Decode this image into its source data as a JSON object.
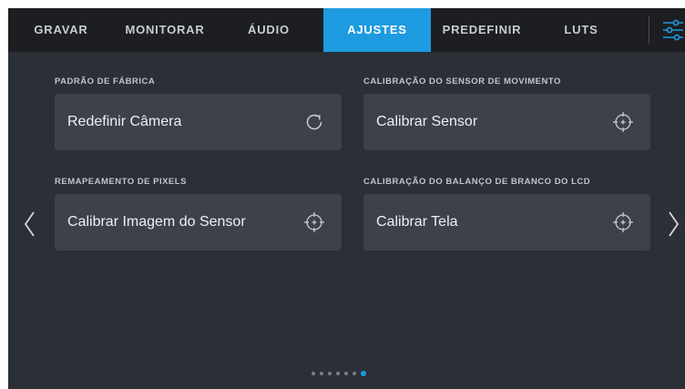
{
  "tabs": [
    {
      "label": "GRAVAR",
      "active": false
    },
    {
      "label": "MONITORAR",
      "active": false
    },
    {
      "label": "ÁUDIO",
      "active": false
    },
    {
      "label": "AJUSTES",
      "active": true
    },
    {
      "label": "PREDEFINIR",
      "active": false
    },
    {
      "label": "LUTS",
      "active": false
    }
  ],
  "menu_icon": "sliders-icon",
  "sections": {
    "factory_reset": {
      "title": "PADRÃO DE FÁBRICA",
      "button": "Redefinir Câmera",
      "icon": "refresh-icon"
    },
    "motion_sensor": {
      "title": "CALIBRAÇÃO DO SENSOR DE MOVIMENTO",
      "button": "Calibrar Sensor",
      "icon": "crosshair-icon"
    },
    "pixel_remap": {
      "title": "REMAPEAMENTO DE PIXELS",
      "button": "Calibrar Imagem do Sensor",
      "icon": "crosshair-icon"
    },
    "lcd_white_balance": {
      "title": "CALIBRAÇÃO DO BALANÇO DE BRANCO DO LCD",
      "button": "Calibrar Tela",
      "icon": "crosshair-icon"
    }
  },
  "navigation": {
    "prev_icon": "chevron-left-icon",
    "next_icon": "chevron-right-icon"
  },
  "pagination": {
    "total": 7,
    "current": 7
  },
  "colors": {
    "accent": "#1e9ae0",
    "background": "#2b2f36",
    "topbar": "#1c1e22",
    "card": "#3c414a"
  }
}
